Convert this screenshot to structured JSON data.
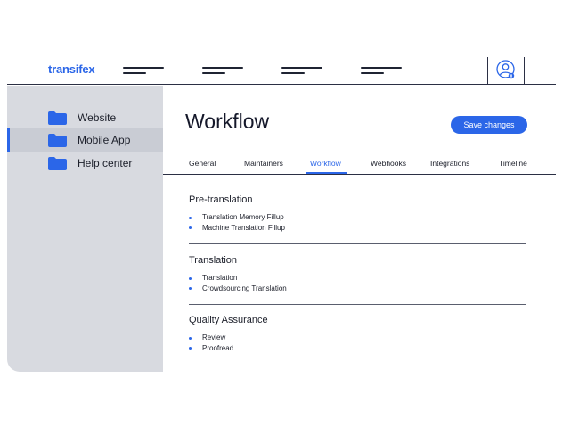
{
  "header": {
    "logo": "transifex",
    "nav_items": [
      "menu-1",
      "menu-2",
      "menu-3",
      "menu-4"
    ],
    "avatar_icon": "user-avatar-icon"
  },
  "sidebar": {
    "items": [
      {
        "label": "Website",
        "icon": "folder-icon",
        "active": false
      },
      {
        "label": "Mobile App",
        "icon": "folder-icon",
        "active": true
      },
      {
        "label": "Help center",
        "icon": "folder-icon",
        "active": false
      }
    ]
  },
  "main": {
    "title": "Workflow",
    "save_label": "Save changes",
    "tabs": [
      {
        "label": "General",
        "active": false
      },
      {
        "label": "Maintainers",
        "active": false
      },
      {
        "label": "Workflow",
        "active": true
      },
      {
        "label": "Webhooks",
        "active": false
      },
      {
        "label": "Integrations",
        "active": false
      },
      {
        "label": "Timeline",
        "active": false
      }
    ],
    "sections": [
      {
        "title": "Pre-translation",
        "items": [
          "Translation Memory Fillup",
          "Machine Translation Fillup"
        ]
      },
      {
        "title": "Translation",
        "items": [
          "Translation",
          "Crowdsourcing Translation"
        ]
      },
      {
        "title": "Quality Assurance",
        "items": [
          "Review",
          "Proofread"
        ]
      }
    ]
  },
  "colors": {
    "accent": "#2b66e8",
    "sidebar_bg": "#d8dae0",
    "sidebar_active_bg": "#c9ccd4",
    "text": "#1c1f2a"
  }
}
